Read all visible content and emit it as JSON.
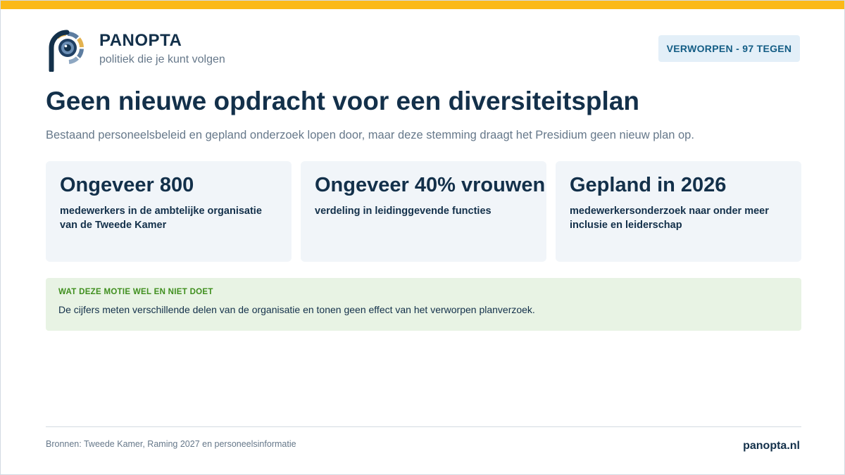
{
  "brand": {
    "name": "PANOPTA",
    "tagline": "politiek die je kunt volgen"
  },
  "status_badge": "VERWORPEN - 97 TEGEN",
  "title": "Geen nieuwe opdracht voor een diversiteitsplan",
  "subtitle": "Bestaand personeelsbeleid en gepland onderzoek lopen door, maar deze stemming draagt het Presidium geen nieuw plan op.",
  "cards": [
    {
      "value": "Ongeveer 800",
      "description": "medewerkers in de ambtelijke organisatie van de Tweede Kamer"
    },
    {
      "value": "Ongeveer 40% vrouwen",
      "description": "verdeling in leidinggevende functies"
    },
    {
      "value": "Gepland in 2026",
      "description": "medewerkersonderzoek naar onder meer inclusie en leiderschap"
    }
  ],
  "note": {
    "heading": "WAT DEZE MOTIE WEL EN NIET DOET",
    "text": "De cijfers meten verschillende delen van de organisatie en tonen geen effect van het verworpen planverzoek."
  },
  "footer": {
    "sources": "Bronnen: Tweede Kamer, Raming 2027 en personeelsinformatie",
    "site": "panopta.nl"
  },
  "colors": {
    "accent_bar": "#fbb917",
    "navy": "#13304a",
    "badge_bg": "#e3eff8",
    "note_bg": "#e8f3e4",
    "note_heading": "#3f8f1e"
  },
  "icons": {
    "logo": "panopta-eye-logo"
  }
}
